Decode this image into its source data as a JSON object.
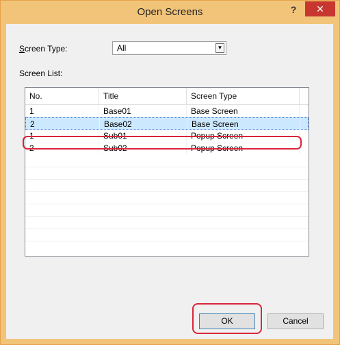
{
  "window": {
    "title": "Open Screens",
    "help_label": "?",
    "close_label": "✕"
  },
  "screen_type": {
    "label_prefix": "S",
    "label_rest": "creen Type:",
    "value": "All"
  },
  "screen_list_label": "Screen List:",
  "grid": {
    "columns": [
      "No.",
      "Title",
      "Screen Type"
    ],
    "rows": [
      [
        "1",
        "Base01",
        "Base Screen"
      ],
      [
        "2",
        "Base02",
        "Base Screen"
      ],
      [
        "1",
        "Sub01",
        "Popup Screen"
      ],
      [
        "2",
        "Sub02",
        "Popup Screen"
      ]
    ],
    "selected_index": 1
  },
  "buttons": {
    "ok": "OK",
    "cancel": "Cancel"
  },
  "colors": {
    "title_bar": "#f2c47a",
    "close_button": "#c7372f",
    "selection": "#cce8ff",
    "callout": "#d9253a"
  }
}
